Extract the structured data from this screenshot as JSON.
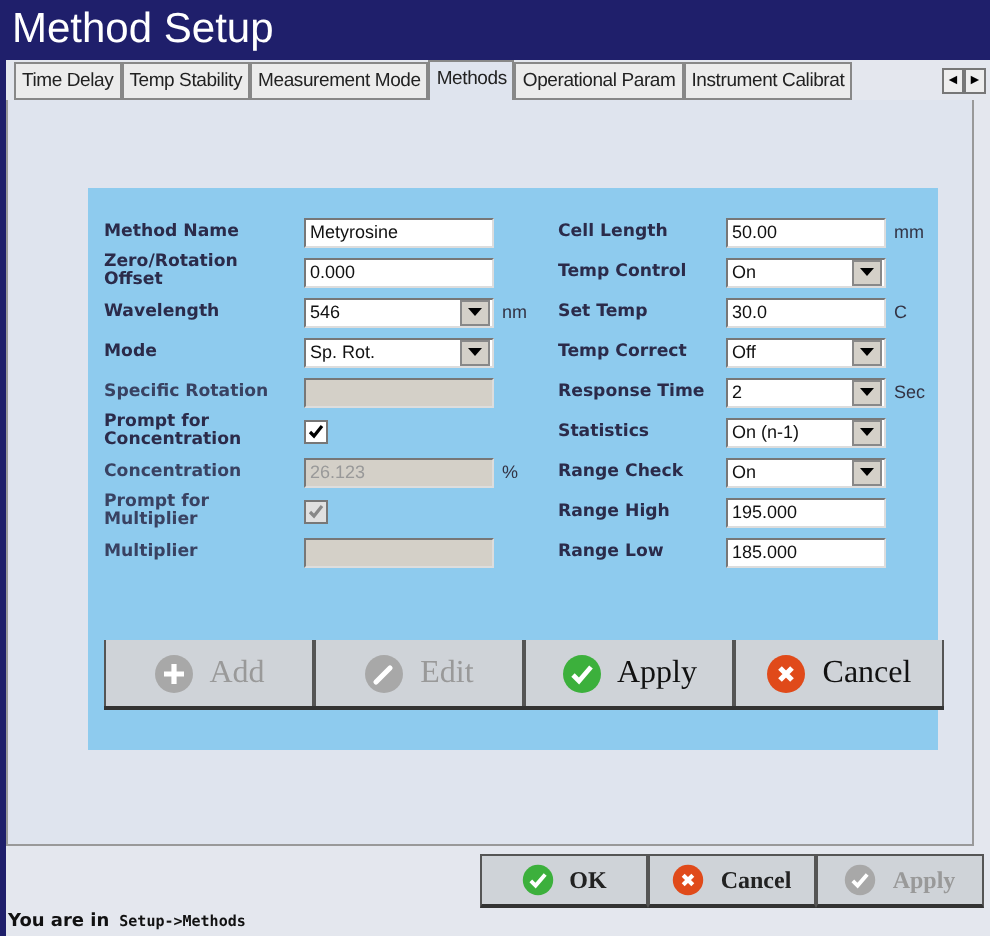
{
  "window": {
    "title": "Method Setup"
  },
  "tabs": [
    {
      "label": "Time Delay",
      "selected": false
    },
    {
      "label": "Temp Stability",
      "selected": false
    },
    {
      "label": "Measurement Mode",
      "selected": false
    },
    {
      "label": "Methods",
      "selected": true
    },
    {
      "label": "Operational Param",
      "selected": false
    },
    {
      "label": "Instrument Calibrat",
      "selected": false
    }
  ],
  "tab_scroll": [
    "◄",
    "►"
  ],
  "form": {
    "left": [
      {
        "kind": "text",
        "label": "Method Name",
        "value": "Metyrosine",
        "disabled": false
      },
      {
        "kind": "text",
        "label": "Zero/Rotation Offset",
        "value": "0.000",
        "disabled": false
      },
      {
        "kind": "select",
        "label": "Wavelength",
        "value": "546",
        "unit": "nm",
        "disabled": false
      },
      {
        "kind": "select",
        "label": "Mode",
        "value": "Sp. Rot.",
        "disabled": false
      },
      {
        "kind": "text",
        "label": "Specific Rotation",
        "disabled": true
      },
      {
        "kind": "checkbox",
        "label": "Prompt for Concentration",
        "checked": true,
        "disabled": false
      },
      {
        "kind": "text",
        "label": "Concentration",
        "value": "26.123",
        "unit": "%",
        "disabled": true
      },
      {
        "kind": "checkbox",
        "label": "Prompt for Multiplier",
        "checked": true,
        "disabled": true
      },
      {
        "kind": "text",
        "label": "Multiplier",
        "disabled": true
      }
    ],
    "right": [
      {
        "kind": "text",
        "label": "Cell Length",
        "value": "50.00",
        "unit": "mm",
        "disabled": false
      },
      {
        "kind": "select",
        "label": "Temp Control",
        "value": "On",
        "disabled": false
      },
      {
        "kind": "text",
        "label": "Set Temp",
        "value": "30.0",
        "unit": "C",
        "disabled": false
      },
      {
        "kind": "select",
        "label": "Temp Correct",
        "value": "Off",
        "disabled": false
      },
      {
        "kind": "select",
        "label": "Response Time",
        "value": "2",
        "unit": "Sec",
        "disabled": false
      },
      {
        "kind": "select",
        "label": "Statistics",
        "value": "On (n-1)",
        "disabled": false
      },
      {
        "kind": "select",
        "label": "Range Check",
        "value": "On",
        "disabled": false
      },
      {
        "kind": "text",
        "label": "Range High",
        "value": "195.000",
        "disabled": false
      },
      {
        "kind": "text",
        "label": "Range Low",
        "value": "185.000",
        "disabled": false
      }
    ]
  },
  "actions": [
    {
      "kind": "add",
      "label": "Add",
      "disabled": true
    },
    {
      "kind": "edit",
      "label": "Edit",
      "disabled": true
    },
    {
      "kind": "apply",
      "label": "Apply",
      "disabled": false
    },
    {
      "kind": "cancel",
      "label": "Cancel",
      "disabled": false
    }
  ],
  "dialog_buttons": [
    {
      "kind": "apply",
      "label": "OK",
      "disabled": false
    },
    {
      "kind": "cancel",
      "label": "Cancel",
      "disabled": false
    },
    {
      "kind": "apply",
      "label": "Apply",
      "disabled": true
    }
  ],
  "status_bar": {
    "prefix": "You are in",
    "path": "Setup->Methods"
  }
}
